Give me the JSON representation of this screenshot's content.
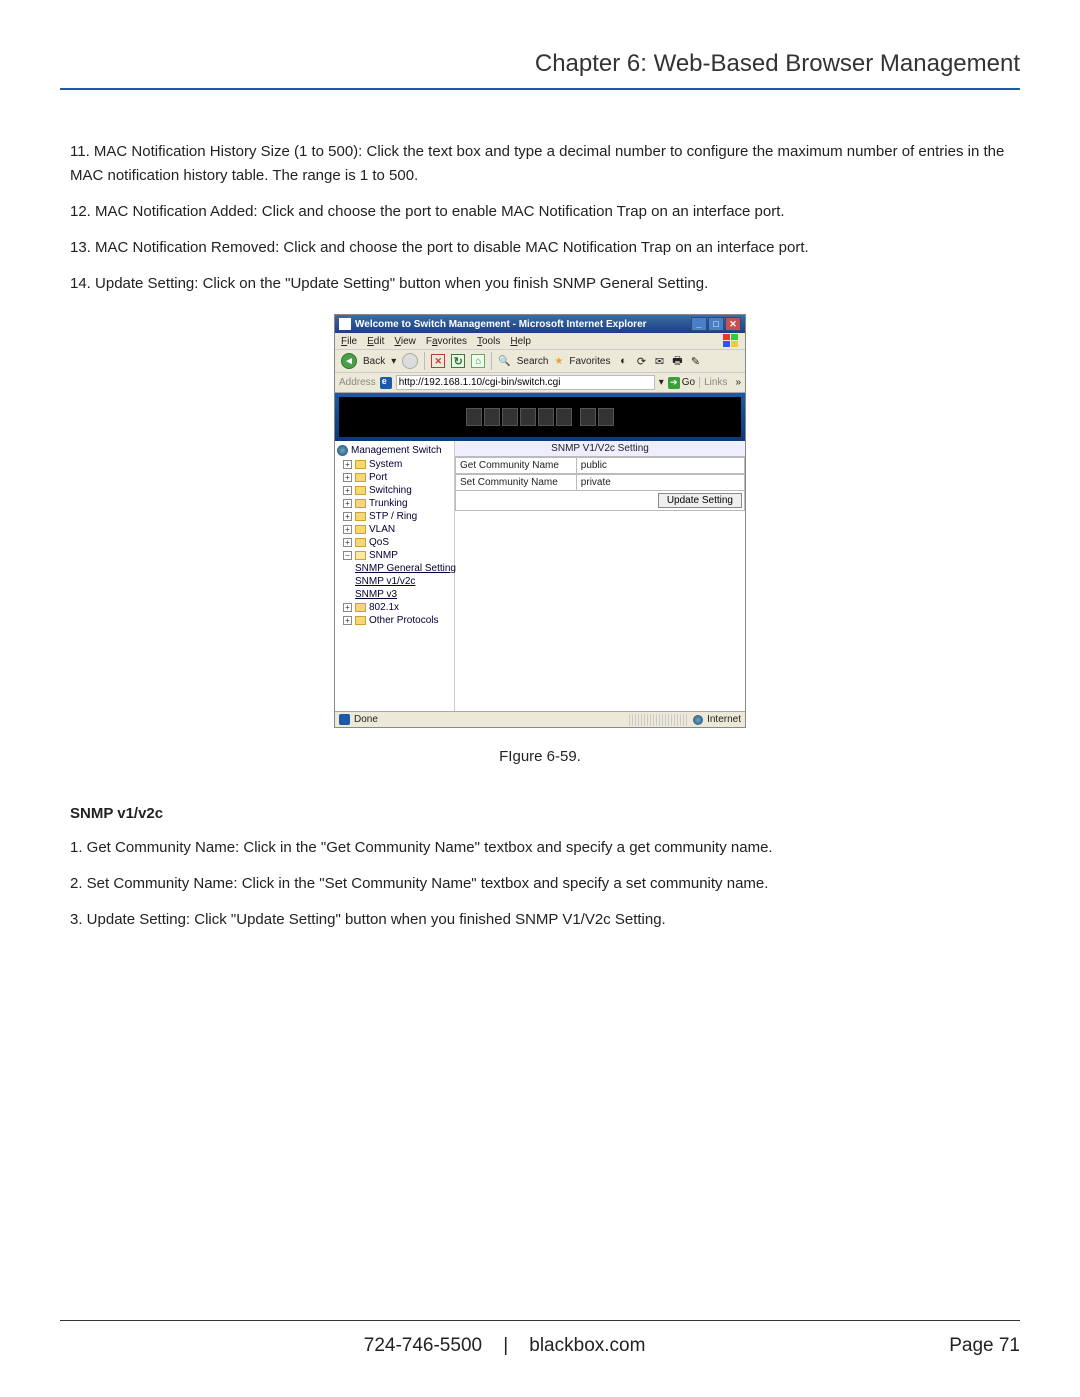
{
  "header": {
    "chapter_title": "Chapter 6: Web-Based Browser Management"
  },
  "body": {
    "p11": "11. MAC Notification History Size (1 to 500): Click the text box and type a decimal number to configure the maximum number of entries in the MAC notification history table. The range is 1 to 500.",
    "p12": "12. MAC Notification Added: Click and choose the port to enable MAC Notification Trap on an interface port.",
    "p13": "13. MAC Notification Removed: Click and choose the port to disable MAC Notification Trap on an interface port.",
    "p14": "14. Update Setting: Click on the \"Update Setting\" button when you finish SNMP General Setting.",
    "figure_caption": "FIgure 6-59.",
    "subheading": "SNMP v1/v2c",
    "s1": "1. Get Community Name: Click in the \"Get Community Name\" textbox and specify a get community name.",
    "s2": "2. Set Community Name: Click in the \"Set Community Name\" textbox and specify a set community name.",
    "s3": "3. Update Setting: Click \"Update Setting\" button when you finished SNMP V1/V2c Setting."
  },
  "screenshot": {
    "window_title": "Welcome to Switch Management - Microsoft Internet Explorer",
    "menu": {
      "file": "File",
      "edit": "Edit",
      "view": "View",
      "favorites": "Favorites",
      "tools": "Tools",
      "help": "Help"
    },
    "toolbar": {
      "back": "Back",
      "search": "Search",
      "favorites": "Favorites"
    },
    "addressbar": {
      "label": "Address",
      "url": "http://192.168.1.10/cgi-bin/switch.cgi",
      "go": "Go",
      "links": "Links"
    },
    "tree": {
      "root": "Management Switch",
      "items": [
        "System",
        "Port",
        "Switching",
        "Trunking",
        "STP / Ring",
        "VLAN",
        "QoS",
        "SNMP",
        "802.1x",
        "Other Protocols"
      ],
      "snmp_children": [
        "SNMP General Setting",
        "SNMP v1/v2c",
        "SNMP v3"
      ]
    },
    "panel": {
      "title": "SNMP V1/V2c Setting",
      "get_label": "Get Community Name",
      "get_value": "public",
      "set_label": "Set Community Name",
      "set_value": "private",
      "update_btn": "Update Setting"
    },
    "statusbar": {
      "done": "Done",
      "zone": "Internet"
    }
  },
  "footer": {
    "phone": "724-746-5500",
    "sep": "|",
    "site": "blackbox.com",
    "page_label": "Page 71"
  }
}
